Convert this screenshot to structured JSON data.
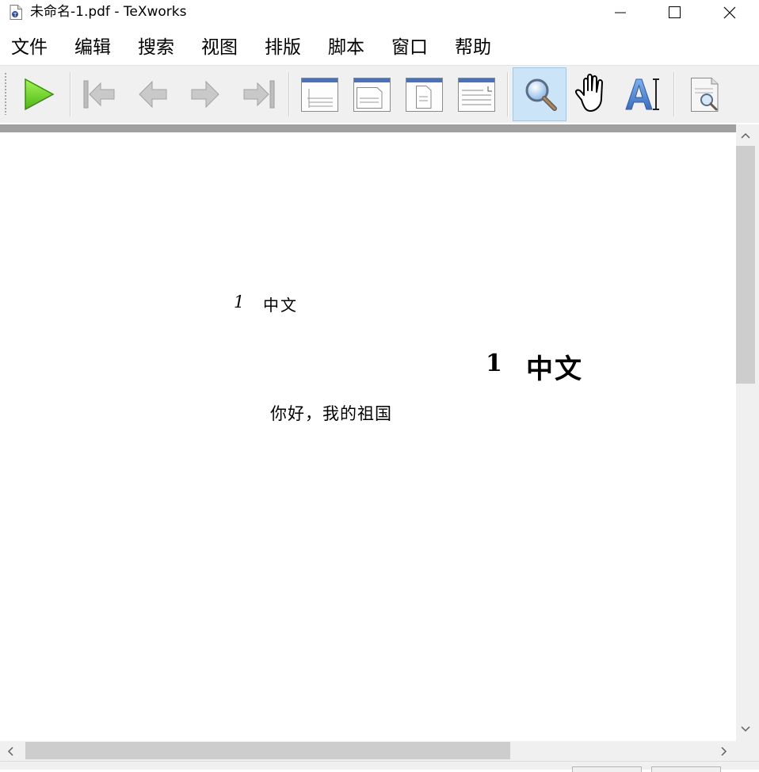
{
  "window": {
    "title": "未命名-1.pdf - TeXworks",
    "app_icon": "pdf-document-icon",
    "controls": [
      "minimize-icon",
      "maximize-icon",
      "close-icon"
    ]
  },
  "menu": {
    "items": [
      "文件",
      "编辑",
      "搜索",
      "视图",
      "排版",
      "脚本",
      "窗口",
      "帮助"
    ]
  },
  "toolbar": {
    "buttons": [
      {
        "name": "typeset",
        "icon": "play-icon",
        "active": false
      },
      {
        "name": "first-page",
        "icon": "first-page-icon",
        "active": false
      },
      {
        "name": "previous-page",
        "icon": "previous-page-icon",
        "active": false
      },
      {
        "name": "next-page",
        "icon": "next-page-icon",
        "active": false
      },
      {
        "name": "last-page",
        "icon": "last-page-icon",
        "active": false
      },
      {
        "name": "actual-size",
        "icon": "actual-size-icon",
        "active": false
      },
      {
        "name": "fit-width",
        "icon": "fit-width-icon",
        "active": false
      },
      {
        "name": "fit-window",
        "icon": "fit-window-icon",
        "active": false
      },
      {
        "name": "fit-text",
        "icon": "fit-text-icon",
        "active": false
      },
      {
        "name": "magnify-tool",
        "icon": "magnifier-icon",
        "active": true
      },
      {
        "name": "scroll-tool",
        "icon": "hand-icon",
        "active": false
      },
      {
        "name": "select-text-tool",
        "icon": "text-select-icon",
        "active": false
      },
      {
        "name": "find",
        "icon": "find-document-icon",
        "active": false
      }
    ]
  },
  "document": {
    "toc_entry": {
      "number": "1",
      "title": "中文"
    },
    "section": {
      "number": "1",
      "title": "中文"
    },
    "body": "你好，我的祖国"
  },
  "scrollbars": {
    "vertical": {
      "position": 0.0,
      "visible_fraction": 0.39
    },
    "horizontal": {
      "position": 0.0,
      "visible_fraction": 0.71
    }
  },
  "colors": {
    "active_tool_bg": "#cce4f7",
    "typeset_green": "#6fcf1f",
    "toolbar_bg": "#f0f0f0"
  }
}
